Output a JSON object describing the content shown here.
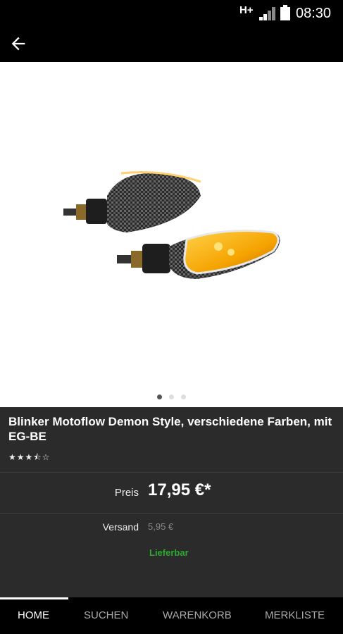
{
  "status_bar": {
    "network": "H+",
    "time": "08:30"
  },
  "product": {
    "title": "Blinker Motoflow Demon Style, verschiedene Farben, mit EG-BE",
    "rating": 3.5,
    "rating_max": 5,
    "stars_text": "★★★⯪☆",
    "price_label": "Preis",
    "price": "17,95 €*",
    "shipping_label": "Versand",
    "shipping": "5,95 €",
    "availability": "Lieferbar"
  },
  "gallery": {
    "pages": 3,
    "current": 1
  },
  "nav": {
    "items": [
      {
        "label": "HOME",
        "active": true
      },
      {
        "label": "SUCHEN",
        "active": false
      },
      {
        "label": "WARENKORB",
        "active": false
      },
      {
        "label": "MERKLISTE",
        "active": false
      }
    ]
  },
  "colors": {
    "availability": "#2ea82e",
    "info_bg": "#2b2b2b",
    "amber_lens": "#f5a300"
  }
}
